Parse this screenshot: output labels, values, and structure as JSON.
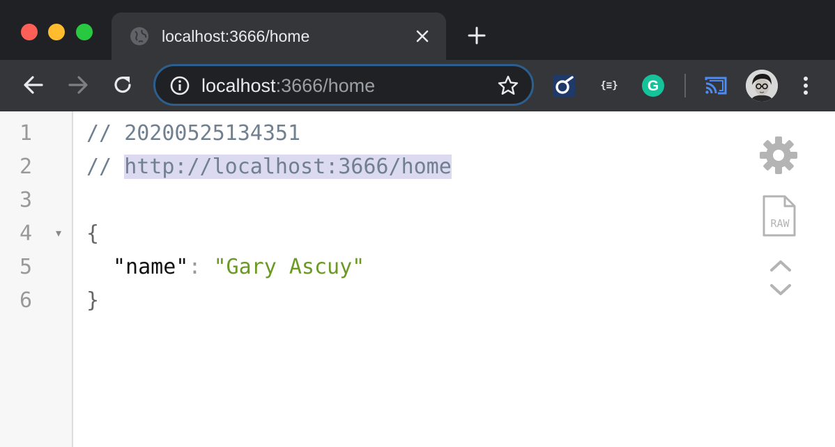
{
  "window": {
    "controls": [
      "close",
      "minimize",
      "zoom"
    ]
  },
  "tab": {
    "title": "localhost:3666/home",
    "favicon": "globe-icon"
  },
  "toolbar": {
    "url_host": "localhost",
    "url_rest": ":3666/home",
    "extensions": [
      "jsonviewer-a-icon",
      "json-formatter-icon",
      "grammarly-icon",
      "cast-icon"
    ],
    "json_ext_label": "{≡}",
    "grammarly_label": "G"
  },
  "editor": {
    "line_numbers": [
      "1",
      "2",
      "3",
      "4",
      "5",
      "6"
    ],
    "comment_prefix": "// ",
    "timestamp": "20200525134351",
    "source_url": "http://localhost:3666/home",
    "open_brace": "{",
    "close_brace": "}",
    "key": "\"name\"",
    "colon": ": ",
    "value": "\"Gary Ascuy\"",
    "fold_marker": "▾"
  },
  "side_tools": {
    "raw_label": "RAW"
  },
  "colors": {
    "titlebar": "#202124",
    "toolbar": "#35363a",
    "omnibox_border": "#2d5f8e",
    "comment": "#708090",
    "string": "#6a9a24",
    "highlight": "#dcdaf0"
  }
}
